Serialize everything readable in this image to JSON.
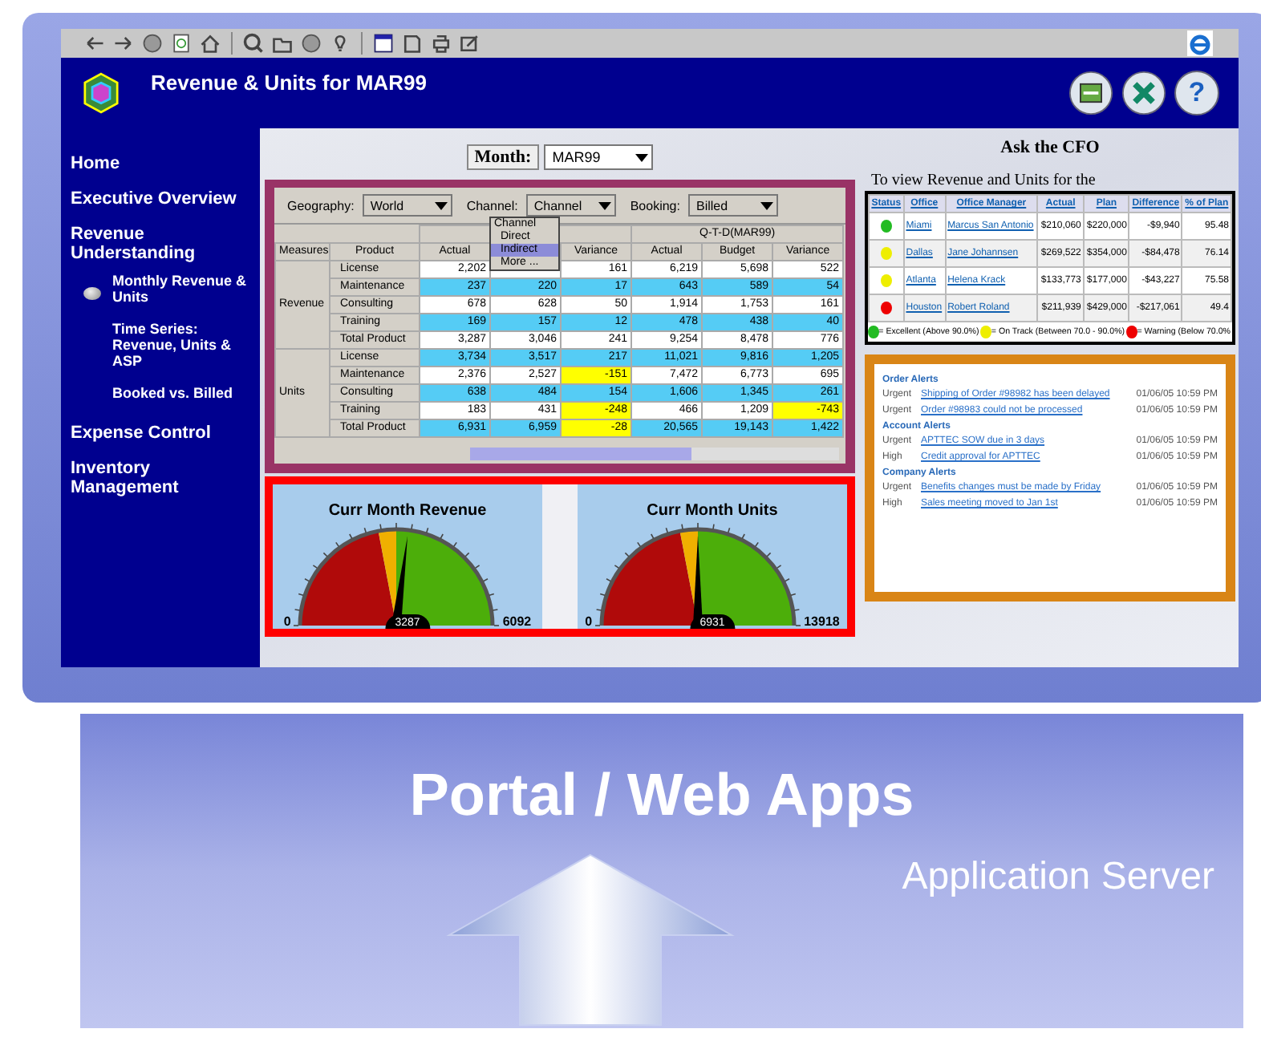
{
  "window": {
    "title": "Revenue & Units for MAR99",
    "help_label": "?"
  },
  "sidebar": {
    "items": [
      {
        "label": "Home"
      },
      {
        "label": "Executive Overview"
      },
      {
        "label": "Revenue Understanding",
        "children": [
          {
            "label": "Monthly Revenue & Units",
            "selected": true
          },
          {
            "label": "Time Series: Revenue, Units & ASP",
            "selected": false
          },
          {
            "label": "Booked vs. Billed",
            "selected": false
          }
        ]
      },
      {
        "label": "Expense Control"
      },
      {
        "label": "Inventory Management"
      }
    ]
  },
  "month": {
    "label": "Month:",
    "value": "MAR99"
  },
  "pivot": {
    "filters": [
      {
        "label": "Geography:",
        "value": "World"
      },
      {
        "label": "Channel:",
        "value": "Channel"
      },
      {
        "label": "Booking:",
        "value": "Billed"
      }
    ],
    "channel_menu": [
      {
        "label": "Channel",
        "selected": false
      },
      {
        "label": "Direct",
        "selected": false
      },
      {
        "label": "Indirect",
        "selected": true
      },
      {
        "label": "More ...",
        "selected": false
      }
    ],
    "group_headers": [
      "Q-T-D(MAR99)"
    ],
    "columns": [
      "Measures",
      "Product",
      "Actual",
      "Variance",
      "Actual",
      "Budget",
      "Variance"
    ],
    "groups": [
      {
        "measure": "Revenue",
        "rows": [
          {
            "product": "License",
            "shaded": false,
            "values": [
              "2,202",
              "161",
              "6,219",
              "5,698",
              "522"
            ],
            "warn": [
              false,
              false,
              false,
              false,
              false
            ]
          },
          {
            "product": "Maintenance",
            "shaded": true,
            "values": [
              "237",
              "220",
              "17",
              "643",
              "589",
              "54"
            ],
            "warn": [
              false,
              false,
              false,
              false,
              false,
              false
            ]
          },
          {
            "product": "Consulting",
            "shaded": false,
            "values": [
              "678",
              "628",
              "50",
              "1,914",
              "1,753",
              "161"
            ],
            "warn": [
              false,
              false,
              false,
              false,
              false,
              false
            ]
          },
          {
            "product": "Training",
            "shaded": true,
            "values": [
              "169",
              "157",
              "12",
              "478",
              "438",
              "40"
            ],
            "warn": [
              false,
              false,
              false,
              false,
              false,
              false
            ]
          },
          {
            "product": "Total Product",
            "shaded": false,
            "values": [
              "3,287",
              "3,046",
              "241",
              "9,254",
              "8,478",
              "776"
            ],
            "warn": [
              false,
              false,
              false,
              false,
              false,
              false
            ]
          }
        ]
      },
      {
        "measure": "Units",
        "rows": [
          {
            "product": "License",
            "shaded": true,
            "values": [
              "3,734",
              "3,517",
              "217",
              "11,021",
              "9,816",
              "1,205"
            ],
            "warn": [
              false,
              false,
              false,
              false,
              false,
              false
            ]
          },
          {
            "product": "Maintenance",
            "shaded": false,
            "values": [
              "2,376",
              "2,527",
              "-151",
              "7,472",
              "6,773",
              "695"
            ],
            "warn": [
              false,
              false,
              true,
              false,
              false,
              false
            ]
          },
          {
            "product": "Consulting",
            "shaded": true,
            "values": [
              "638",
              "484",
              "154",
              "1,606",
              "1,345",
              "261"
            ],
            "warn": [
              false,
              false,
              false,
              false,
              false,
              false
            ]
          },
          {
            "product": "Training",
            "shaded": false,
            "values": [
              "183",
              "431",
              "-248",
              "466",
              "1,209",
              "-743"
            ],
            "warn": [
              false,
              false,
              true,
              false,
              false,
              true
            ]
          },
          {
            "product": "Total Product",
            "shaded": true,
            "values": [
              "6,931",
              "6,959",
              "-28",
              "20,565",
              "19,143",
              "1,422"
            ],
            "warn": [
              false,
              false,
              true,
              false,
              false,
              false
            ]
          }
        ]
      }
    ]
  },
  "gauges": [
    {
      "title": "Curr Month Revenue",
      "min": "0",
      "max": "6092",
      "reading": "3287",
      "level": 0.54
    },
    {
      "title": "Curr Month Units",
      "min": "0",
      "max": "13918",
      "reading": "6931",
      "level": 0.5
    }
  ],
  "cfo": {
    "title": "Ask the CFO",
    "intro": "To view Revenue and Units for the",
    "columns": [
      "Status",
      "Office",
      "Office Manager",
      "Actual",
      "Plan",
      "Difference",
      "% of Plan"
    ],
    "rows": [
      {
        "color": "#22bb22",
        "office": "Miami",
        "manager": "Marcus San Antonio",
        "actual": "$210,060",
        "plan": "$220,000",
        "difference": "-$9,940",
        "percent": "95.48"
      },
      {
        "color": "#eeee00",
        "office": "Dallas",
        "manager": "Jane Johannsen",
        "actual": "$269,522",
        "plan": "$354,000",
        "difference": "-$84,478",
        "percent": "76.14"
      },
      {
        "color": "#eeee00",
        "office": "Atlanta",
        "manager": "Helena Krack",
        "actual": "$133,773",
        "plan": "$177,000",
        "difference": "-$43,227",
        "percent": "75.58"
      },
      {
        "color": "#ee0000",
        "office": "Houston",
        "manager": "Robert Roland",
        "actual": "$211,939",
        "plan": "$429,000",
        "difference": "-$217,061",
        "percent": "49.4"
      }
    ],
    "legend": [
      {
        "color": "#22bb22",
        "text": "= Excellent (Above 90.0%)"
      },
      {
        "color": "#eeee00",
        "text": "= On Track (Between 70.0 - 90.0%)"
      },
      {
        "color": "#ee0000",
        "text": "= Warning (Below 70.0%"
      }
    ]
  },
  "alerts": [
    {
      "title": "Order Alerts",
      "items": [
        {
          "priority": "Urgent",
          "text": "Shipping of Order #98982 has been delayed",
          "time": "01/06/05 10:59 PM"
        },
        {
          "priority": "Urgent",
          "text": "Order #98983 could not be processed",
          "time": "01/06/05 10:59 PM"
        }
      ]
    },
    {
      "title": "Account Alerts",
      "items": [
        {
          "priority": "Urgent",
          "text": "APTTEC SOW due in 3 days",
          "time": "01/06/05 10:59 PM"
        },
        {
          "priority": "High",
          "text": "Credit approval for APTTEC",
          "time": "01/06/05 10:59 PM"
        }
      ]
    },
    {
      "title": "Company Alerts",
      "items": [
        {
          "priority": "Urgent",
          "text": "Benefits changes must be made by Friday",
          "time": "01/06/05 10:59 PM"
        },
        {
          "priority": "High",
          "text": "Sales meeting moved to Jan 1st",
          "time": "01/06/05 10:59 PM"
        }
      ]
    }
  ],
  "base": {
    "title": "Portal / Web Apps",
    "subtitle": "Application Server"
  }
}
